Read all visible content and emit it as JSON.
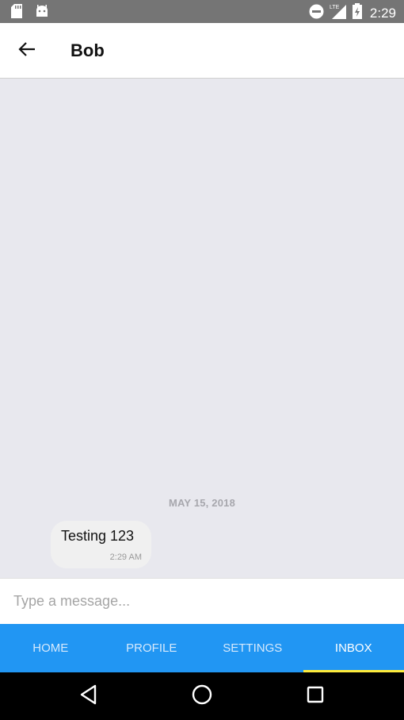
{
  "status_bar": {
    "time": "2:29",
    "network_label": "LTE",
    "icons": [
      "sd-card-icon",
      "android-debug-icon",
      "do-not-disturb-icon",
      "signal-icon",
      "battery-charging-icon"
    ]
  },
  "header": {
    "title": "Bob",
    "back_icon": "arrow-left-icon"
  },
  "chat": {
    "date_separator": "MAY 15, 2018",
    "messages": [
      {
        "text": "Testing 123",
        "time": "2:29 AM"
      }
    ]
  },
  "composer": {
    "placeholder": "Type a message...",
    "value": ""
  },
  "tabs": [
    {
      "label": "HOME",
      "active": false
    },
    {
      "label": "PROFILE",
      "active": false
    },
    {
      "label": "SETTINGS",
      "active": false
    },
    {
      "label": "INBOX",
      "active": true
    }
  ],
  "colors": {
    "tab_bar": "#2196f3",
    "active_indicator": "#ffeb3b",
    "chat_background": "#e8e8ee"
  },
  "nav_bar": {
    "icons": [
      "back-triangle-icon",
      "home-circle-icon",
      "recents-square-icon"
    ]
  }
}
